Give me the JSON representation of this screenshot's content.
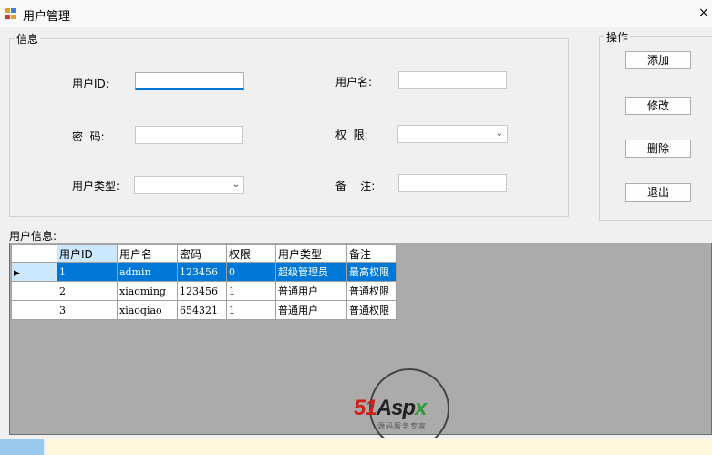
{
  "window": {
    "title": "用户管理",
    "close_glyph": "×"
  },
  "info_group": {
    "title": "信息",
    "user_id_label": "用户ID:",
    "user_id_value": "",
    "username_label": "用户名:",
    "username_value": "",
    "password_label": "密  码:",
    "password_value": "",
    "permission_label": "权  限:",
    "permission_value": "",
    "user_type_label": "用户类型:",
    "user_type_value": "",
    "remark_label": "备    注:",
    "remark_value": ""
  },
  "ops_group": {
    "title": "操作",
    "add": "添加",
    "edit": "修改",
    "delete": "删除",
    "exit": "退出"
  },
  "grid": {
    "label": "用户信息:",
    "columns": [
      "用户ID",
      "用户名",
      "密码",
      "权限",
      "用户类型",
      "备注"
    ],
    "rows": [
      [
        "1",
        "admin",
        "123456",
        "0",
        "超级管理员",
        "最高权限"
      ],
      [
        "2",
        "xiaoming",
        "123456",
        "1",
        "普通用户",
        "普通权限"
      ],
      [
        "3",
        "xiaoqiao",
        "654321",
        "1",
        "普通用户",
        "普通权限"
      ]
    ],
    "selected_row": 0
  },
  "watermark": {
    "logo_51": "51",
    "logo_asp": "Asp",
    "logo_x": "x",
    "subtitle": "源码服务专家"
  },
  "colors": {
    "selection": "#0078d7",
    "header_selected": "#cce8ff",
    "grid_background": "#ababab"
  }
}
